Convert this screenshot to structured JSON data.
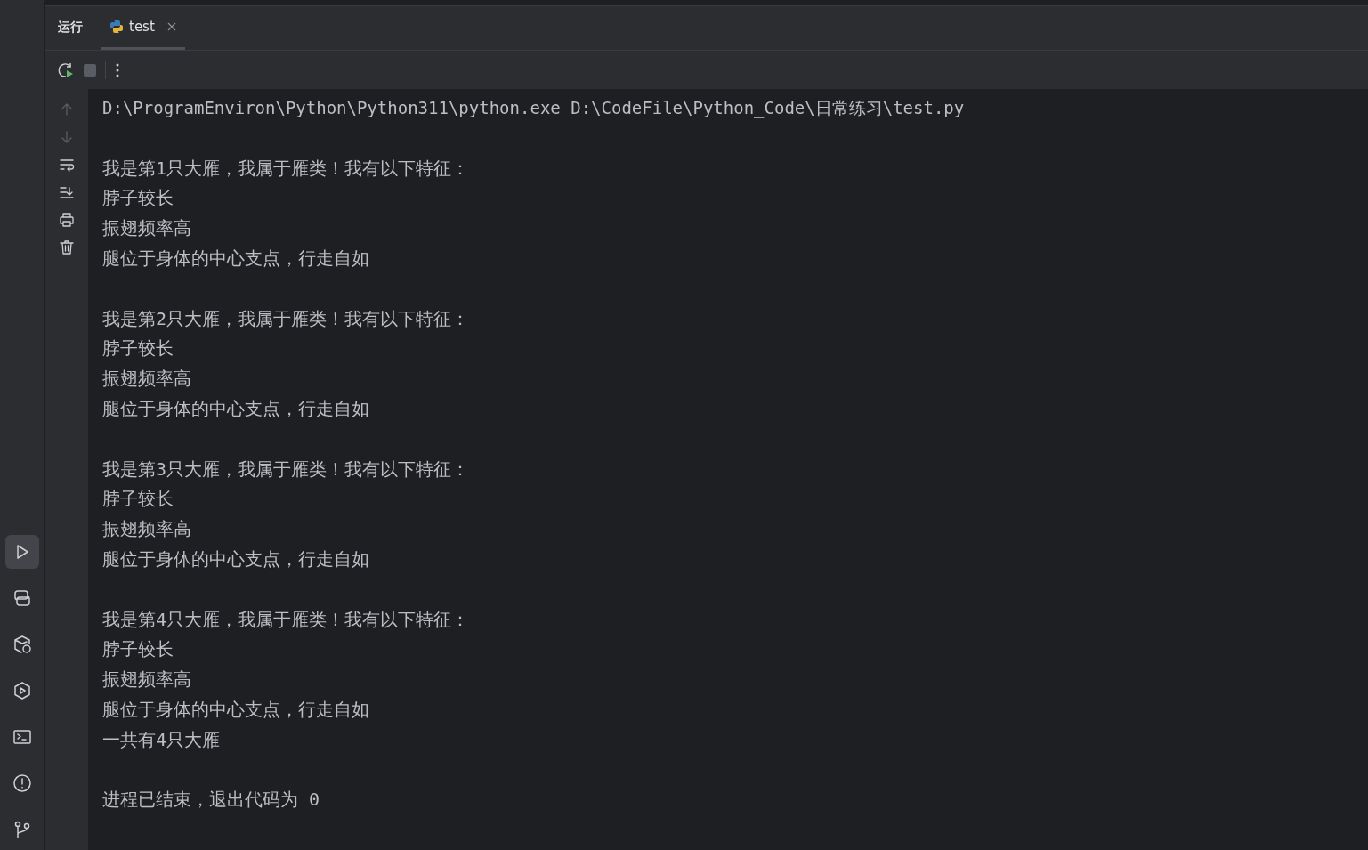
{
  "panel": {
    "title": "运行",
    "tabs": [
      {
        "label": "test",
        "selected": true
      }
    ]
  },
  "tool_stripe": [
    {
      "selected": true
    },
    {
      "selected": false
    },
    {
      "selected": false
    },
    {
      "selected": false
    },
    {
      "selected": false
    },
    {
      "selected": false
    },
    {
      "selected": false
    }
  ],
  "console_actions": [
    {
      "disabled": true
    },
    {
      "disabled": true
    },
    {
      "disabled": false
    },
    {
      "disabled": false
    },
    {
      "disabled": false
    },
    {
      "disabled": false
    }
  ],
  "console": {
    "blocks": [
      {
        "kind": "command",
        "lines": [
          "D:\\ProgramEnviron\\Python\\Python311\\python.exe D:\\CodeFile\\Python_Code\\日常练习\\test.py"
        ]
      },
      {
        "kind": "output",
        "lines": [
          "我是第1只大雁，我属于雁类！我有以下特征：",
          "脖子较长",
          "振翅频率高",
          "腿位于身体的中心支点，行走自如"
        ]
      },
      {
        "kind": "output",
        "lines": [
          "我是第2只大雁，我属于雁类！我有以下特征：",
          "脖子较长",
          "振翅频率高",
          "腿位于身体的中心支点，行走自如"
        ]
      },
      {
        "kind": "output",
        "lines": [
          "我是第3只大雁，我属于雁类！我有以下特征：",
          "脖子较长",
          "振翅频率高",
          "腿位于身体的中心支点，行走自如"
        ]
      },
      {
        "kind": "output",
        "lines": [
          "我是第4只大雁，我属于雁类！我有以下特征：",
          "脖子较长",
          "振翅频率高",
          "腿位于身体的中心支点，行走自如",
          "一共有4只大雁"
        ]
      },
      {
        "kind": "output",
        "lines": [
          "进程已结束，退出代码为 0"
        ]
      }
    ]
  }
}
